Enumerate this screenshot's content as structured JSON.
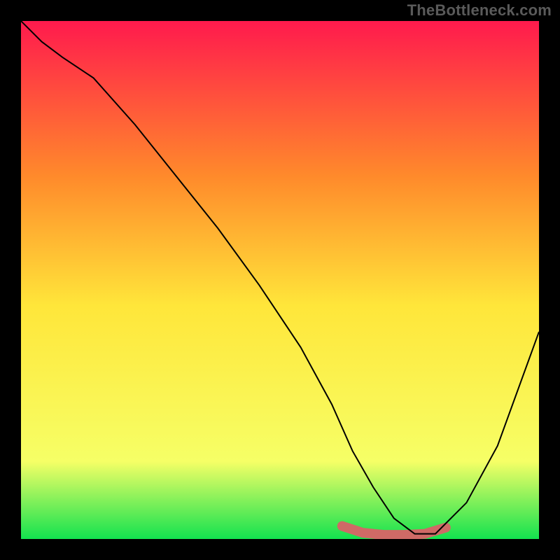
{
  "watermark": "TheBottleneck.com",
  "chart_data": {
    "type": "area",
    "title": "",
    "xlabel": "",
    "ylabel": "",
    "xlim": [
      0,
      100
    ],
    "ylim": [
      0,
      100
    ],
    "background_gradient": {
      "top": "#ff1a4d",
      "mid_upper": "#ff8a2b",
      "mid": "#ffe63a",
      "lower": "#f6ff66",
      "bottom": "#13e24f"
    },
    "curve": {
      "name": "bottleneck-curve",
      "color": "#000000",
      "x": [
        0,
        4,
        8,
        14,
        22,
        30,
        38,
        46,
        54,
        60,
        64,
        68,
        72,
        76,
        80,
        86,
        92,
        100
      ],
      "y": [
        100,
        96,
        93,
        89,
        80,
        70,
        60,
        49,
        37,
        26,
        17,
        10,
        4,
        1,
        1,
        7,
        18,
        40
      ]
    },
    "highlight_segment": {
      "color": "#cf6a66",
      "thickness_px": 14,
      "x": [
        62,
        66,
        70,
        74,
        78,
        82
      ],
      "y": [
        2.5,
        1.2,
        0.8,
        0.8,
        1.0,
        2.2
      ]
    }
  }
}
